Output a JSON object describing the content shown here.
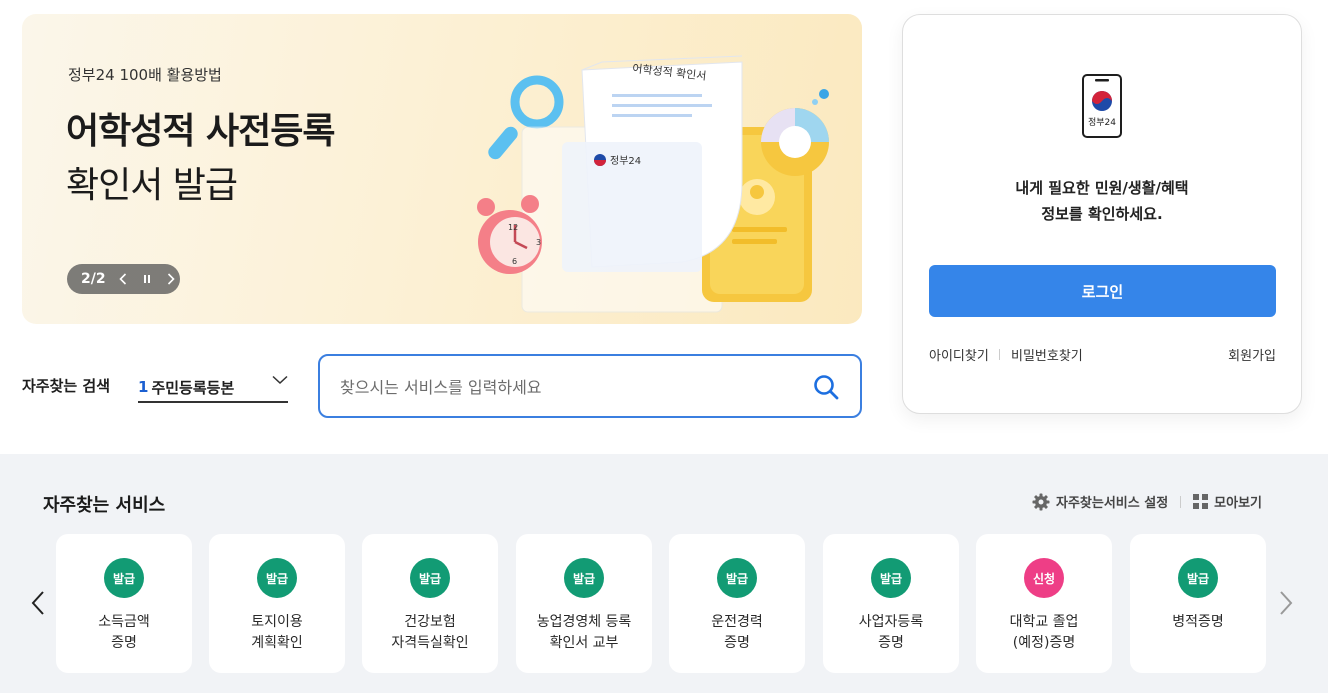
{
  "banner": {
    "subtitle": "정부24 100배 활용방법",
    "title_line1": "어학성적 사전등록",
    "title_line2": "확인서 발급",
    "pager": "2/2",
    "art_doc_label": "어학성적 확인서",
    "art_logo_label": "정부24"
  },
  "search": {
    "fav_label": "자주찾는 검색",
    "fav_rank": "1",
    "fav_value": "주민등록등본",
    "placeholder": "찾으시는 서비스를 입력하세요"
  },
  "login": {
    "logo_text": "정부24",
    "message_line1": "내게 필요한 민원/생활/혜택",
    "message_line2": "정보를 확인하세요.",
    "login_button": "로그인",
    "find_id": "아이디찾기",
    "find_pw": "비밀번호찾기",
    "signup": "회원가입"
  },
  "services": {
    "title": "자주찾는 서비스",
    "settings_label": "자주찾는서비스 설정",
    "viewall_label": "모아보기",
    "items": [
      {
        "badge": "발급",
        "type": "issue",
        "line1": "소득금액",
        "line2": "증명"
      },
      {
        "badge": "발급",
        "type": "issue",
        "line1": "토지이용",
        "line2": "계획확인"
      },
      {
        "badge": "발급",
        "type": "issue",
        "line1": "건강보험",
        "line2": "자격득실확인"
      },
      {
        "badge": "발급",
        "type": "issue",
        "line1": "농업경영체 등록",
        "line2": "확인서 교부"
      },
      {
        "badge": "발급",
        "type": "issue",
        "line1": "운전경력",
        "line2": "증명"
      },
      {
        "badge": "발급",
        "type": "issue",
        "line1": "사업자등록",
        "line2": "증명"
      },
      {
        "badge": "신청",
        "type": "apply",
        "line1": "대학교 졸업",
        "line2": "(예정)증명"
      },
      {
        "badge": "발급",
        "type": "issue",
        "line1": "병적증명",
        "line2": ""
      }
    ]
  },
  "colors": {
    "accent_blue": "#3585e9",
    "issue_green": "#129b74",
    "apply_pink": "#ee3e86"
  }
}
